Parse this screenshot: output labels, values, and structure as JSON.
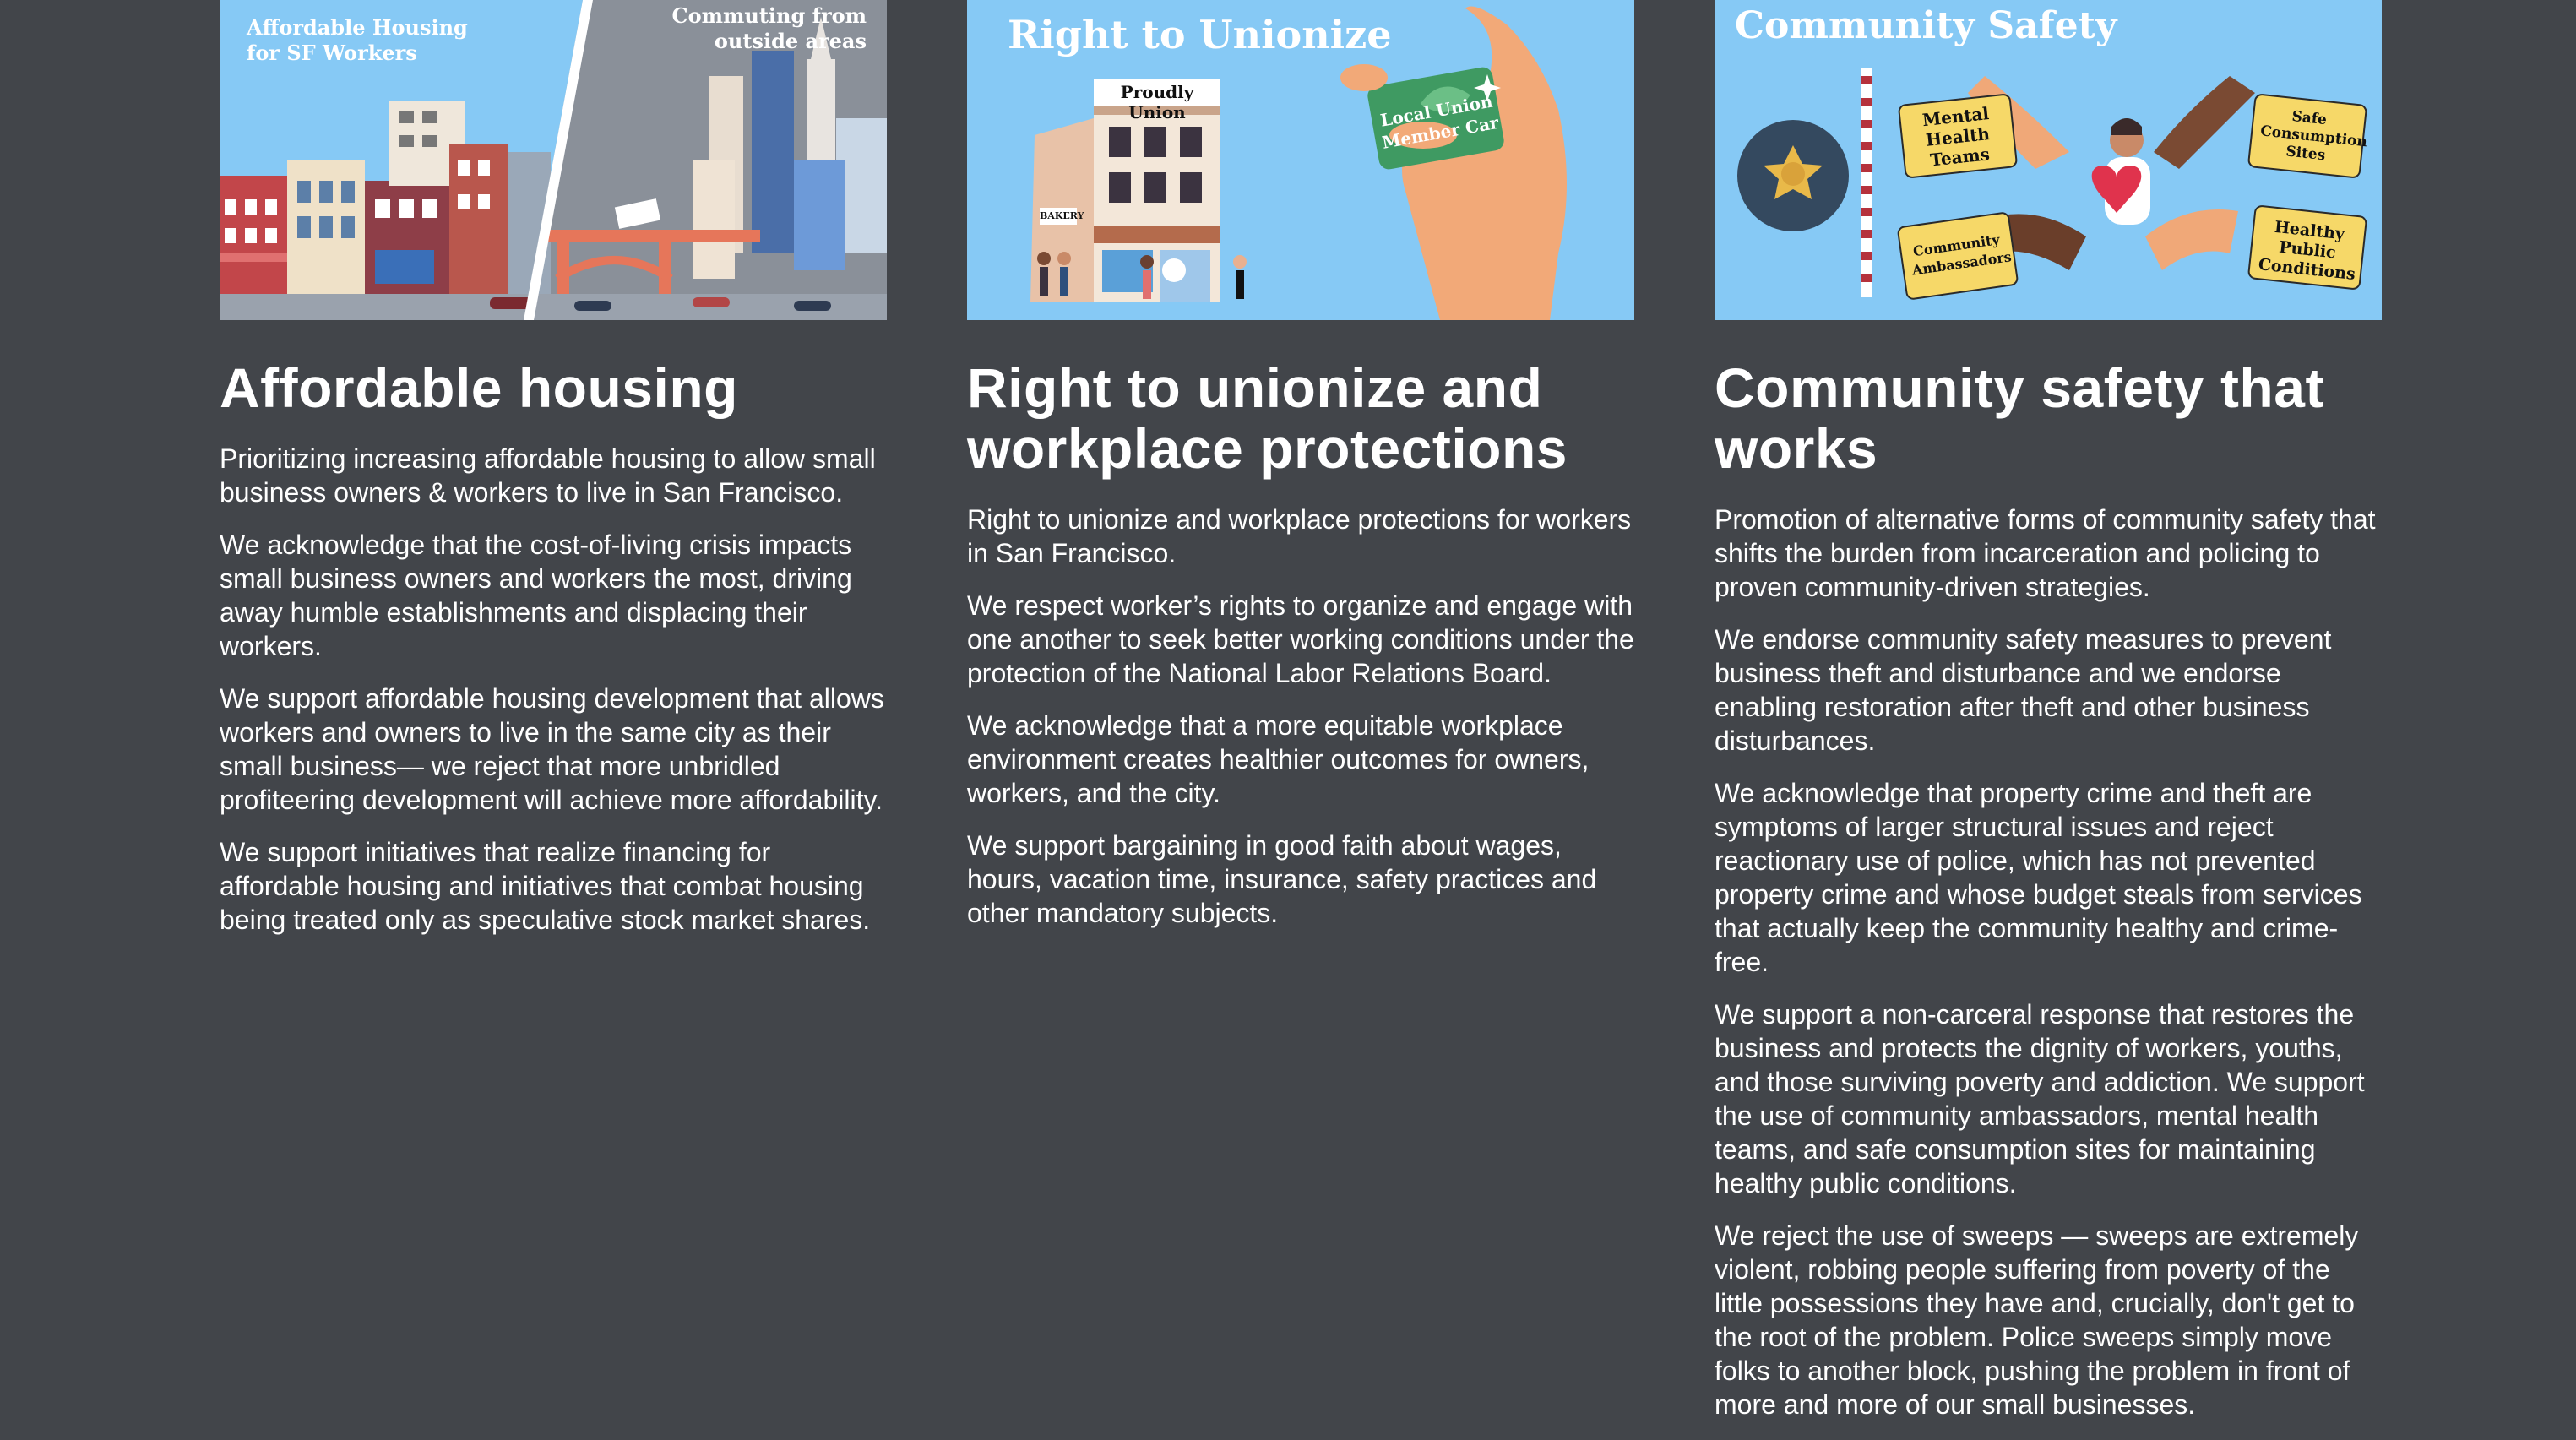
{
  "columns": [
    {
      "image_text": {
        "left_caption_line1": "Affordable Housing",
        "left_caption_line2": "for SF Workers",
        "right_caption_line1": "Commuting from",
        "right_caption_line2": "outside areas"
      },
      "title": "Affordable housing",
      "paragraphs": [
        "Prioritizing increasing affordable housing to allow small business owners & workers to live in San Francisco.",
        "We acknowledge that the cost-of-living crisis impacts small business owners and workers the most, driving away humble establishments and displacing their workers.",
        "We support affordable housing development that allows workers and owners to live in the same city as their small business— we reject that more unbridled profiteering development will achieve more affordability.",
        "We support initiatives that realize financing for affordable housing and initiatives that combat housing being treated only as speculative stock market shares."
      ]
    },
    {
      "image_text": {
        "heading": "Right to Unionize",
        "sign": "Proudly Union",
        "store_sign": "BAKERY",
        "card_line1": "Local Union",
        "card_line2": "Member Car"
      },
      "title": "Right to unionize and workplace protections",
      "paragraphs": [
        "Right to unionize and workplace protections for workers in San Francisco.",
        "We respect worker’s rights to organize and engage with one another to seek better working conditions under the protection of the National Labor Relations Board.",
        "We acknowledge that a more equitable workplace environment creates healthier outcomes for owners, workers, and the city.",
        "We support bargaining in good faith about wages, hours, vacation time, insurance, safety practices and other mandatory subjects."
      ]
    },
    {
      "image_text": {
        "heading": "Community Safety",
        "card1": "Mental Health Teams",
        "card2": "Safe Consumption Sites",
        "card3": "Community Ambassadors",
        "card4": "Healthy Public Conditions"
      },
      "title": "Community safety that works",
      "paragraphs": [
        "Promotion of alternative forms of community safety that shifts the burden from incarceration and policing to proven community-driven strategies.",
        "We endorse community safety measures to prevent business theft and disturbance and we endorse enabling restoration after theft and other business disturbances.",
        "We acknowledge that property crime and theft are symptoms of larger structural issues and reject reactionary use of police, which has not prevented property crime and whose budget steals from services that actually keep the community healthy and crime-free.",
        "We support a non-carceral response that restores the business and protects the dignity of workers, youths, and those surviving poverty and addiction. We support the use of community ambassadors, mental health teams, and safe consumption sites for maintaining healthy public conditions.",
        "We reject the use of sweeps — sweeps are extremely violent, robbing people suffering from poverty of the little possessions they have and, crucially, don't get to the root of the problem. Police sweeps simply move folks to another block, pushing the problem in front of more and more of our small businesses."
      ]
    }
  ],
  "colors": {
    "background": "#42454a",
    "sky": "#86c9f5",
    "grey_sky": "#8a9099",
    "card_yellow": "#f6d868",
    "heart": "#e0334d"
  }
}
